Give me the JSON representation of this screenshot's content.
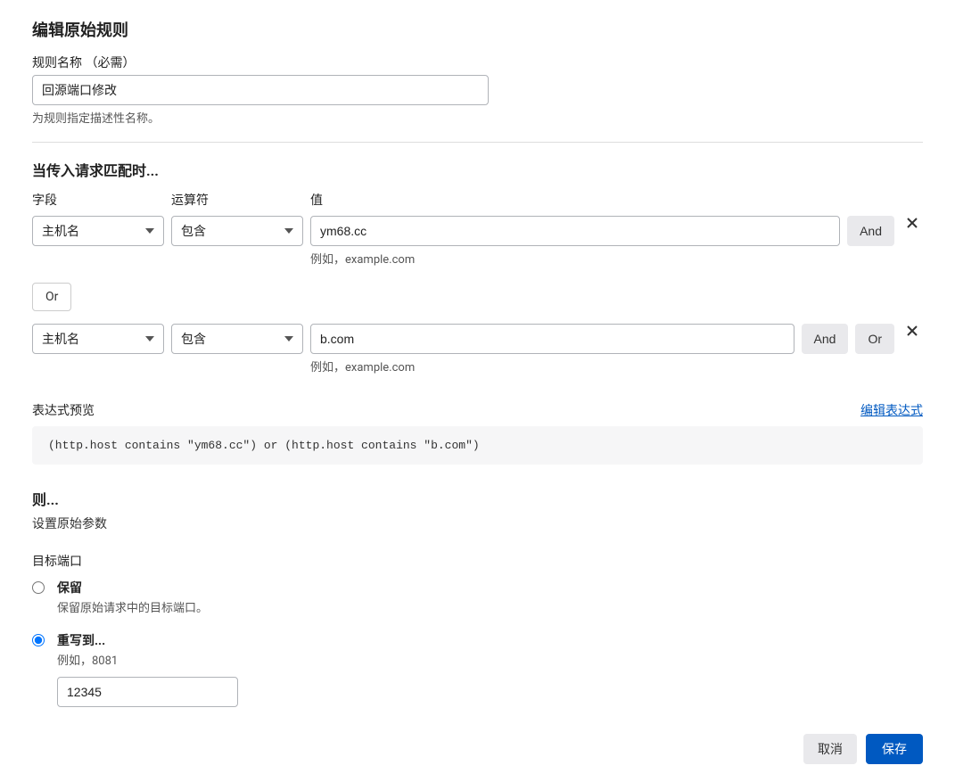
{
  "page": {
    "title": "编辑原始规则"
  },
  "ruleName": {
    "label": "规则名称",
    "required": "（必需）",
    "value": "回源端口修改",
    "help": "为规则指定描述性名称。"
  },
  "match": {
    "title": "当传入请求匹配时...",
    "columns": {
      "field": "字段",
      "operator": "运算符",
      "value": "值"
    },
    "rows": [
      {
        "field": "主机名",
        "operator": "包含",
        "value": "ym68.cc",
        "hint": "例如，example.com",
        "buttons": [
          "And"
        ]
      },
      {
        "field": "主机名",
        "operator": "包含",
        "value": "b.com",
        "hint": "例如，example.com",
        "buttons": [
          "And",
          "Or"
        ]
      }
    ],
    "connector": "Or"
  },
  "expression": {
    "label": "表达式预览",
    "editLink": "编辑表达式",
    "text": "(http.host contains \"ym68.cc\") or (http.host contains \"b.com\")"
  },
  "then": {
    "title": "则...",
    "subtitle": "设置原始参数",
    "portSection": "目标端口",
    "options": {
      "keep": {
        "label": "保留",
        "desc": "保留原始请求中的目标端口。"
      },
      "rewrite": {
        "label": "重写到...",
        "desc": "例如，8081",
        "value": "12345"
      }
    }
  },
  "footer": {
    "cancel": "取消",
    "save": "保存"
  }
}
